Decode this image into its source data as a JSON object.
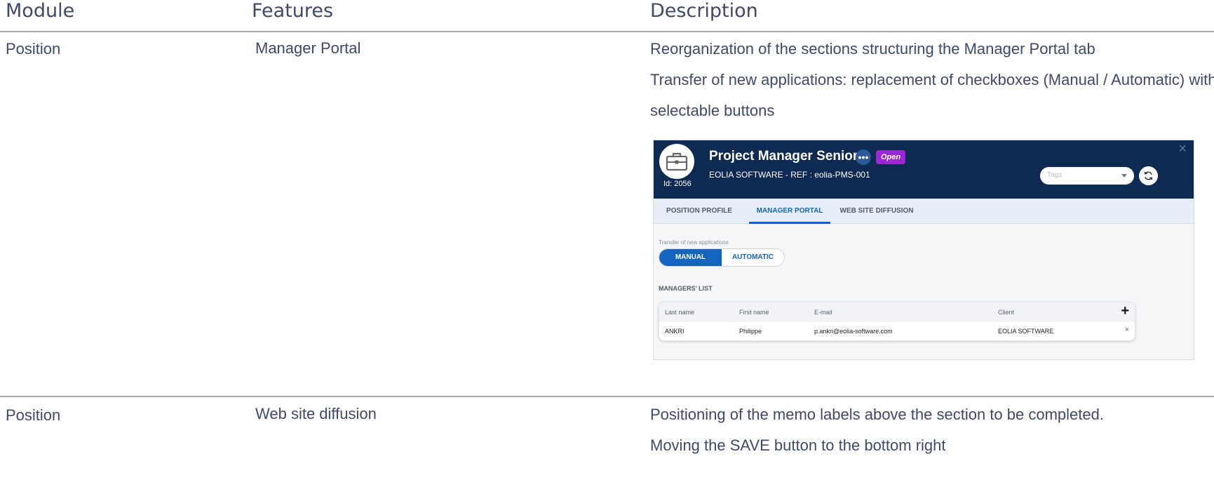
{
  "header": {
    "module": "Module",
    "features": "Features",
    "description": "Description"
  },
  "rows": [
    {
      "module": "Position",
      "feature": "Manager Portal",
      "description_lines": [
        "Reorganization of the sections structuring the Manager Portal tab",
        "Transfer of new applications: replacement of checkboxes (Manual / Automatic) with selectable buttons"
      ]
    },
    {
      "module": "Position",
      "feature": "Web site diffusion",
      "description_lines": [
        "Positioning of the memo labels above the section to be completed.",
        "Moving the SAVE button to the bottom right"
      ]
    }
  ],
  "screenshot": {
    "id_label": "Id: 2056",
    "title": "Project Manager Senior",
    "more_label": "•••",
    "status_badge": "Open",
    "subtitle": "EOLIA SOFTWARE - REF : eolia-PMS-001",
    "close_label": "×",
    "tags_placeholder": "Tags",
    "tabs": [
      {
        "label": "POSITION PROFILE",
        "active": false
      },
      {
        "label": "MANAGER PORTAL",
        "active": true
      },
      {
        "label": "WEB SITE DIFFUSION",
        "active": false
      }
    ],
    "transfer_label": "Transfer of new applications",
    "toggle": {
      "manual": "MANUAL",
      "automatic": "AUTOMATIC",
      "selected": "MANUAL"
    },
    "managers_title": "MANAGERS' LIST",
    "table": {
      "columns": [
        "Last name",
        "First name",
        "E-mail",
        "Client"
      ],
      "add_label": "+",
      "rows": [
        {
          "last_name": "ANKRI",
          "first_name": "Philippe",
          "email": "p.ankri@eolia-software.com",
          "client": "EOLIA SOFTWARE",
          "remove_label": "×"
        }
      ]
    },
    "colors": {
      "header_bg": "#0f2a52",
      "accent": "#1565c0",
      "badge": "#9c27d6",
      "tabs_bg": "#e7eef7"
    }
  }
}
